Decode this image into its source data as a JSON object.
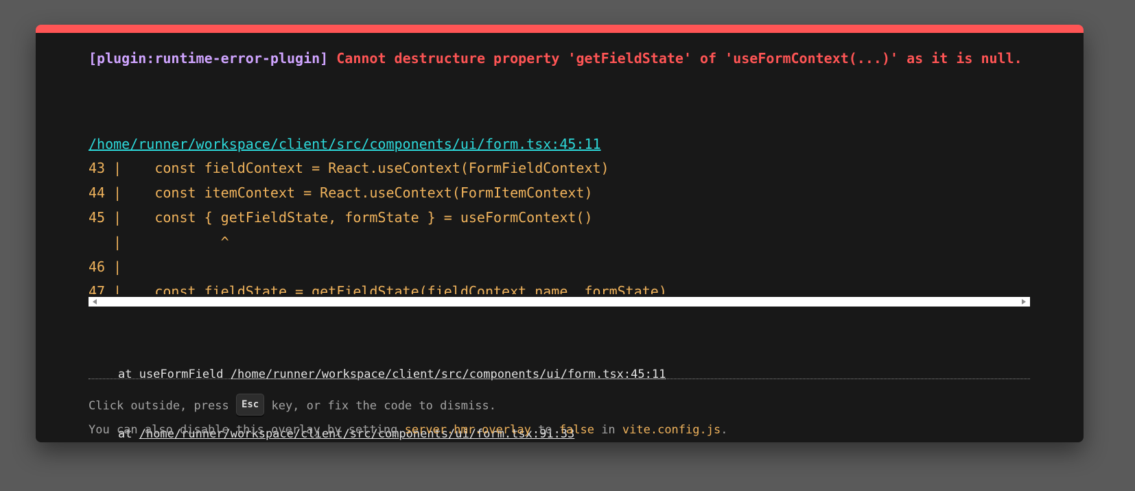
{
  "overlay": {
    "plugin_tag": "[plugin:runtime-error-plugin]",
    "message": "Cannot destructure property 'getFieldState' of 'useFormContext(...)' as it is null.",
    "file": "/home/runner/workspace/client/src/components/ui/form.tsx:45:11",
    "code_lines": [
      "43 |    const fieldContext = React.useContext(FormFieldContext)",
      "44 |    const itemContext = React.useContext(FormItemContext)",
      "45 |    const { getFieldState, formState } = useFormContext()",
      "   |            ^",
      "46 |",
      "47 |    const fieldState = getFieldState(fieldContext.name, formState)"
    ],
    "stack": [
      {
        "prefix": "at useFormField ",
        "location": "/home/runner/workspace/client/src/components/ui/form.tsx:45:11"
      },
      {
        "prefix": "at ",
        "location": "/home/runner/workspace/client/src/components/ui/form.tsx:91:33"
      }
    ],
    "tip": {
      "line1_before": "Click outside, press ",
      "esc_key": "Esc",
      "line1_after": " key, or fix the code to dismiss.",
      "line2_a": "You can also disable this overlay by setting ",
      "line2_code1": "server.hmr.overlay",
      "line2_b": " to ",
      "line2_code2": "false",
      "line2_c": " in ",
      "line2_code3": "vite.config.js",
      "line2_d": "."
    }
  },
  "colors": {
    "backdrop": "#5a5a5a",
    "window_bg": "#181818",
    "accent_red": "#ff5555",
    "plugin_purple": "#cfa4ff",
    "file_cyan": "#2dd9da",
    "code_yellow": "#f0b35c"
  },
  "icons": [
    "scroll-left-arrow-icon",
    "scroll-right-arrow-icon"
  ]
}
